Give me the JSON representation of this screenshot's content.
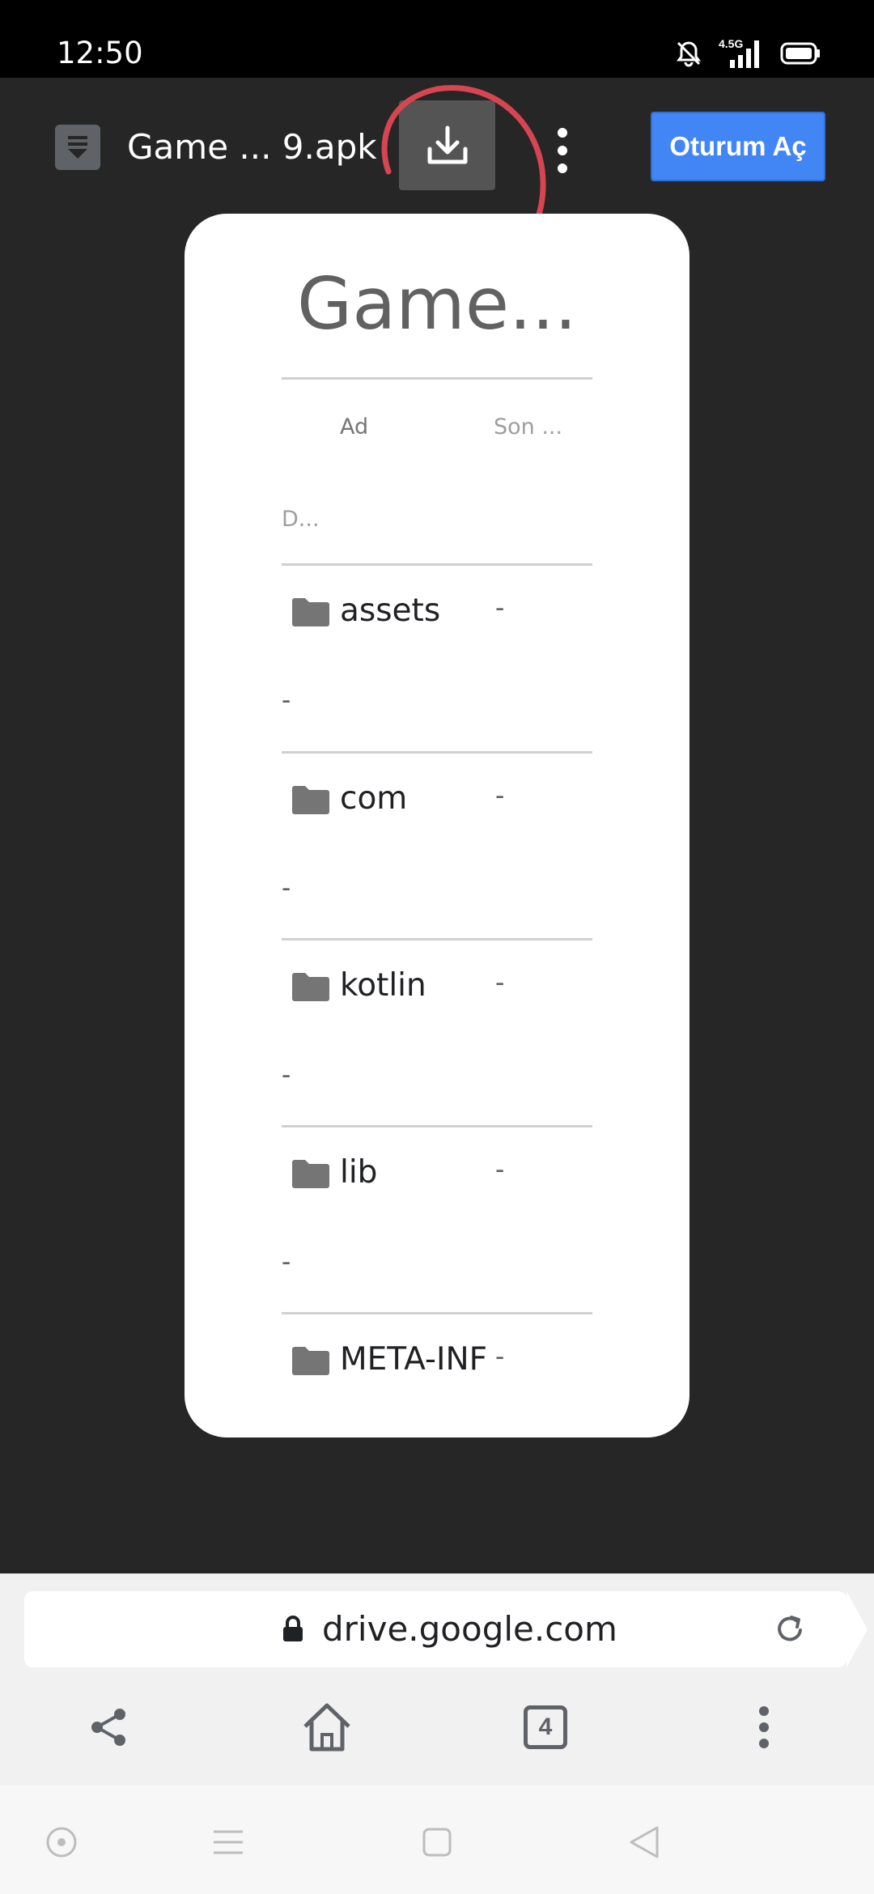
{
  "status_bar": {
    "time": "12:50",
    "network": "4.5G"
  },
  "app_bar": {
    "file_title": "Game ... 9.apk",
    "signin_label": "Oturum Aç"
  },
  "preview": {
    "heading": "Game...",
    "columns": {
      "name": "Ad",
      "modified": "Son ...",
      "size": "D..."
    },
    "rows": [
      {
        "name": "assets",
        "modified": "-",
        "size": "-"
      },
      {
        "name": "com",
        "modified": "-",
        "size": "-"
      },
      {
        "name": "kotlin",
        "modified": "-",
        "size": "-"
      },
      {
        "name": "lib",
        "modified": "-",
        "size": "-"
      },
      {
        "name": "META-INF",
        "modified": "-",
        "size": ""
      }
    ]
  },
  "browser": {
    "url": "drive.google.com",
    "tab_count": "4"
  },
  "colors": {
    "accent": "#4285f4",
    "annotation": "#d64550",
    "background": "#262626"
  }
}
